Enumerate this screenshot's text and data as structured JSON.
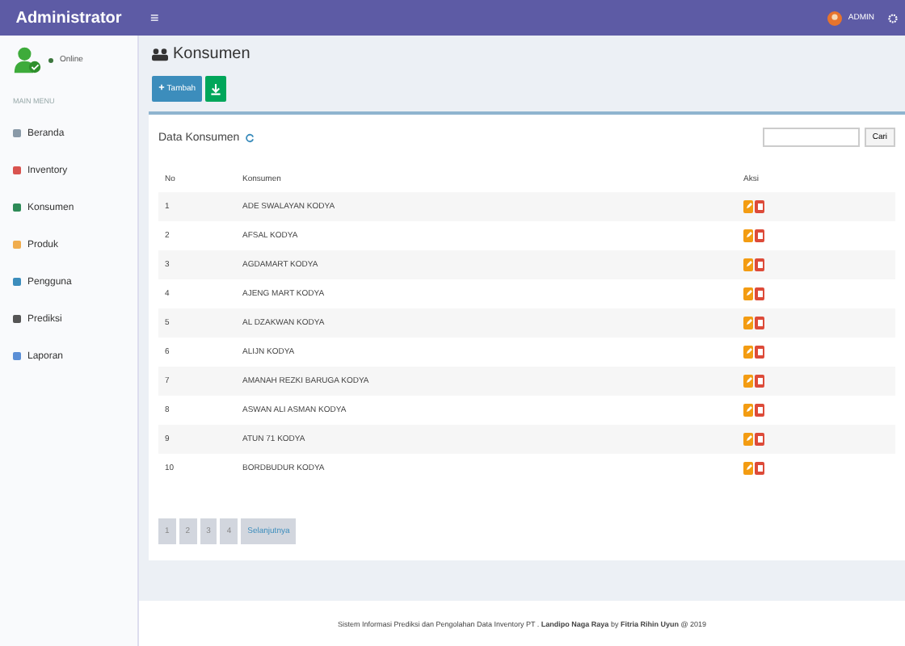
{
  "header": {
    "brand": "Administrator",
    "menu_toggle": "≡",
    "user": "ADMIN"
  },
  "sidebar": {
    "status": "Online",
    "section": "MAIN MENU",
    "items": [
      {
        "label": "Beranda",
        "color": "#8a9aa8"
      },
      {
        "label": "Inventory",
        "color": "#d9534f"
      },
      {
        "label": "Konsumen",
        "color": "#2e8b57"
      },
      {
        "label": "Produk",
        "color": "#f0ad4e"
      },
      {
        "label": "Pengguna",
        "color": "#3c8dbc"
      },
      {
        "label": "Prediksi",
        "color": "#555555"
      },
      {
        "label": "Laporan",
        "color": "#5b8fd6"
      }
    ]
  },
  "page": {
    "title": "Konsumen",
    "add_button": "Tambah"
  },
  "panel": {
    "title": "Data Konsumen",
    "search_button": "Cari"
  },
  "table": {
    "columns": [
      "No",
      "Konsumen",
      "Aksi"
    ],
    "rows": [
      [
        "1",
        "ADE SWALAYAN KODYA"
      ],
      [
        "2",
        "AFSAL KODYA"
      ],
      [
        "3",
        "AGDAMART KODYA"
      ],
      [
        "4",
        "AJENG MART KODYA"
      ],
      [
        "5",
        "AL DZAKWAN KODYA"
      ],
      [
        "6",
        "ALIJN KODYA"
      ],
      [
        "7",
        "AMANAH REZKI BARUGA KODYA"
      ],
      [
        "8",
        "ASWAN ALI ASMAN KODYA"
      ],
      [
        "9",
        "ATUN 71 KODYA"
      ],
      [
        "10",
        "BORDBUDUR KODYA"
      ]
    ]
  },
  "pagination": [
    "1",
    "2",
    "3",
    "4",
    "Selanjutnya"
  ],
  "footer": "Sistem Informasi Prediksi dan Pengolahan Data Inventory PT . **Landipo Naga Raya** by **Fitria Rihin Uyun** @ 2019"
}
